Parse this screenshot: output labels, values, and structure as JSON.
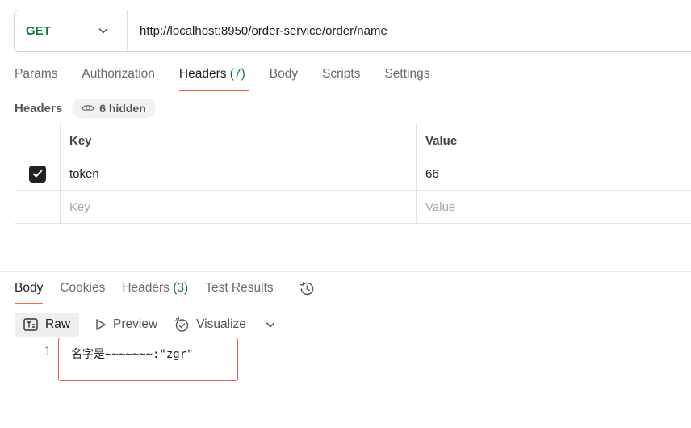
{
  "request": {
    "method": "GET",
    "url": "http://localhost:8950/order-service/order/name"
  },
  "request_tabs": [
    {
      "label": "Params"
    },
    {
      "label": "Authorization"
    },
    {
      "label": "Headers",
      "count": "(7)"
    },
    {
      "label": "Body"
    },
    {
      "label": "Scripts"
    },
    {
      "label": "Settings"
    }
  ],
  "headers_section": {
    "title": "Headers",
    "hidden_label": "6 hidden"
  },
  "table": {
    "col_key": "Key",
    "col_value": "Value",
    "rows": [
      {
        "checked": true,
        "key": "token",
        "value": "66"
      }
    ],
    "placeholder_key": "Key",
    "placeholder_value": "Value"
  },
  "response_tabs": [
    {
      "label": "Body"
    },
    {
      "label": "Cookies"
    },
    {
      "label": "Headers",
      "count": "(3)"
    },
    {
      "label": "Test Results"
    }
  ],
  "response_toolbar": {
    "raw": "Raw",
    "preview": "Preview",
    "visualize": "Visualize"
  },
  "response_body": {
    "line_number": "1",
    "text": "名字是~~~~~~~:\"zgr\""
  },
  "colors": {
    "method_get": "#0b7a3e",
    "accent": "#f26b3a",
    "highlight_box": "#e65a5a"
  }
}
